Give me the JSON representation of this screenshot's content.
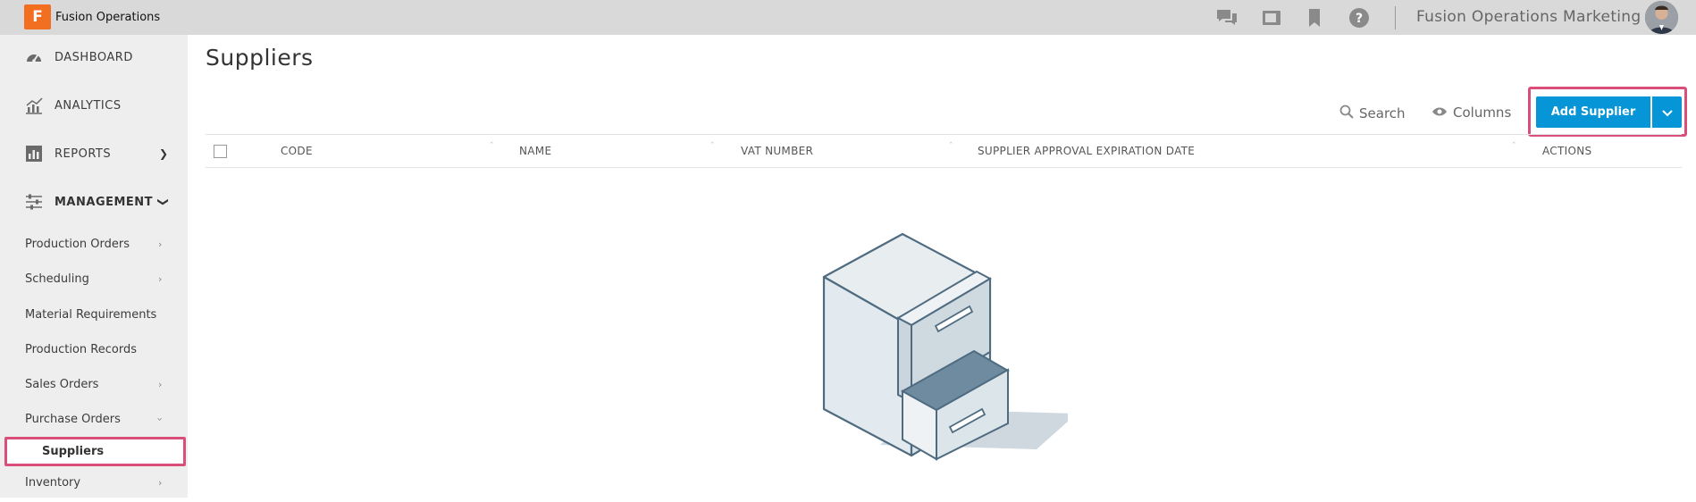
{
  "app": {
    "name": "Fusion Operations",
    "logo_letter": "F",
    "org": "Fusion Operations Marketing"
  },
  "topbar": {
    "icons": [
      "chat-icon",
      "video-icon",
      "bookmark-icon",
      "help-icon"
    ]
  },
  "sidebar": {
    "main_items": [
      {
        "label": "DASHBOARD",
        "icon": "dashboard-gauge-icon"
      },
      {
        "label": "ANALYTICS",
        "icon": "analytics-chart-icon"
      },
      {
        "label": "REPORTS",
        "icon": "reports-icon"
      },
      {
        "label": "MANAGEMENT",
        "icon": "sliders-icon"
      }
    ],
    "sub_items": [
      {
        "label": "Production Orders"
      },
      {
        "label": "Scheduling"
      },
      {
        "label": "Material Requirements"
      },
      {
        "label": "Production Records"
      },
      {
        "label": "Sales Orders"
      },
      {
        "label": "Purchase Orders"
      },
      {
        "label": "Suppliers"
      },
      {
        "label": "Inventory"
      }
    ]
  },
  "page": {
    "title": "Suppliers"
  },
  "toolbar": {
    "search_label": "Search",
    "columns_label": "Columns",
    "add_label": "Add Supplier"
  },
  "table": {
    "columns": [
      "CODE",
      "NAME",
      "VAT NUMBER",
      "SUPPLIER APPROVAL EXPIRATION DATE",
      "ACTIONS"
    ],
    "rows": []
  },
  "colors": {
    "accent": "#0696d7",
    "highlight": "#d94f7a",
    "brand": "#f26f22"
  }
}
